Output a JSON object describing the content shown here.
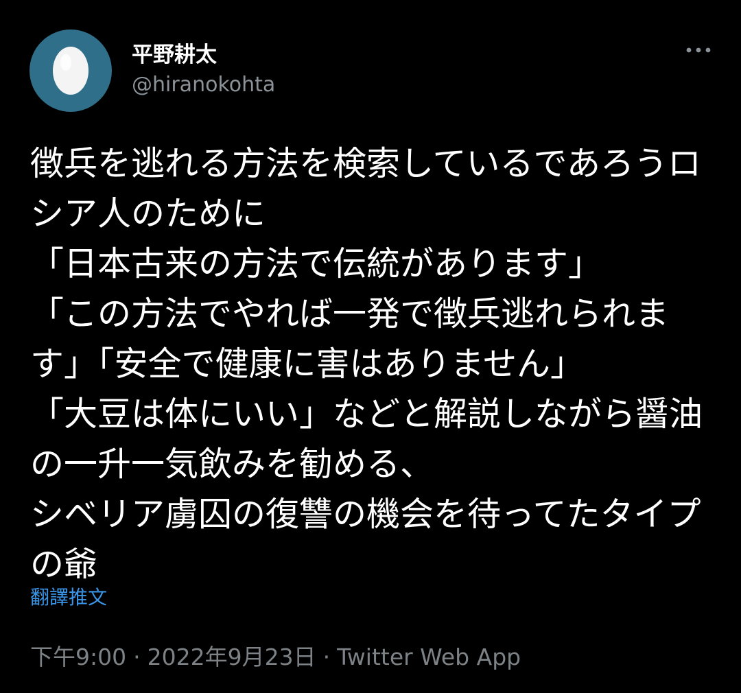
{
  "tweet": {
    "author": {
      "display_name": "平野耕太",
      "handle": "@hiranokohta",
      "avatar_icon": "default-egg-avatar",
      "avatar_color": "#2f6f8a"
    },
    "more_icon": "more-dots-icon",
    "text": "徴兵を逃れる方法を検索しているであろうロシア人のために\n「日本古来の方法で伝統があります」\n「この方法でやれば一発で徴兵逃れられます」「安全で健康に害はありません」\n「大豆は体にいい」などと解説しながら醤油の一升一気飲みを勧める、\nシベリア虜囚の復讐の機会を待ってたタイプの爺",
    "translate_label": "翻譯推文",
    "time": "下午9:00",
    "separator": "·",
    "date": "2022年9月23日",
    "source": "Twitter Web App"
  },
  "colors": {
    "background": "#000000",
    "text": "#ffffff",
    "secondary_text": "#7d8286",
    "link": "#3b95e6"
  }
}
